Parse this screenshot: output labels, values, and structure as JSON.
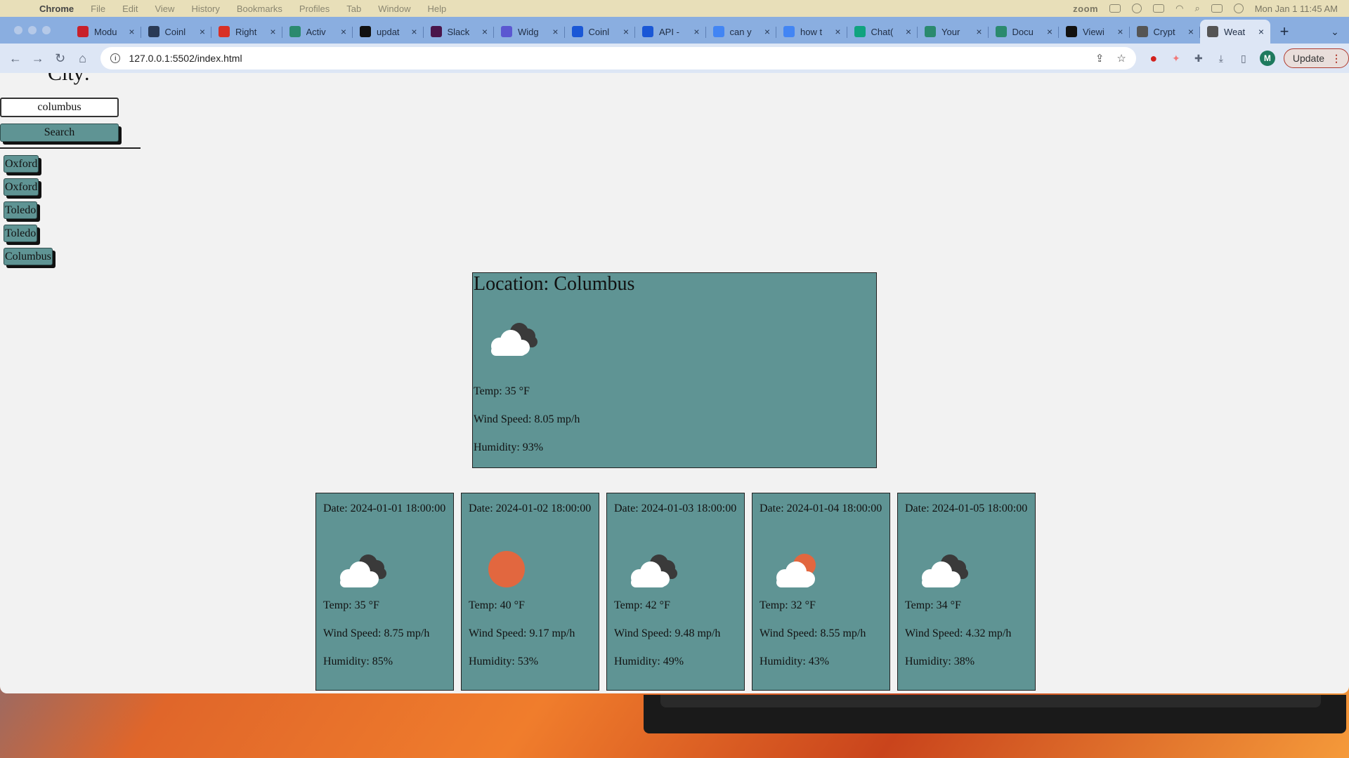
{
  "menubar": {
    "app_name": "Chrome",
    "menus": [
      "File",
      "Edit",
      "View",
      "History",
      "Bookmarks",
      "Profiles",
      "Tab",
      "Window",
      "Help"
    ],
    "zoom_label": "zoom",
    "clock": "Mon Jan 1  11:45 AM"
  },
  "tabs": [
    {
      "title": "Modu",
      "icon": "red-square-icon",
      "color": "#c8202a"
    },
    {
      "title": "Coinl",
      "icon": "coin-logo-icon",
      "color": "#2a3a55"
    },
    {
      "title": "Right",
      "icon": "gmail-icon",
      "color": "#d93025"
    },
    {
      "title": "Activ",
      "icon": "green-check-icon",
      "color": "#2b8a6e"
    },
    {
      "title": "updat",
      "icon": "github-icon",
      "color": "#111111"
    },
    {
      "title": "Slack",
      "icon": "slack-icon",
      "color": "#4a154b"
    },
    {
      "title": "Widg",
      "icon": "m-logo-icon",
      "color": "#5b57d1"
    },
    {
      "title": "Coinl",
      "icon": "c-logo-icon",
      "color": "#1a57d6"
    },
    {
      "title": "API -",
      "icon": "c-logo-icon",
      "color": "#1a57d6"
    },
    {
      "title": "can y",
      "icon": "google-icon",
      "color": "#4285f4"
    },
    {
      "title": "how t",
      "icon": "google-icon",
      "color": "#4285f4"
    },
    {
      "title": "Chat(",
      "icon": "chatgpt-icon",
      "color": "#10a37f"
    },
    {
      "title": "Your",
      "icon": "green-check-icon",
      "color": "#2b8a6e"
    },
    {
      "title": "Docu",
      "icon": "green-check-icon",
      "color": "#2b8a6e"
    },
    {
      "title": "Viewi",
      "icon": "github-icon",
      "color": "#111111"
    },
    {
      "title": "Crypt",
      "icon": "globe-icon",
      "color": "#555555"
    },
    {
      "title": "Weat",
      "icon": "globe-icon",
      "color": "#555555",
      "active": true
    }
  ],
  "toolbar": {
    "url": "127.0.0.1:5502/index.html",
    "avatar_letter": "M",
    "update_label": "Update"
  },
  "page": {
    "city_heading": "City:",
    "search_value": "columbus",
    "search_button": "Search",
    "history": [
      "Oxford",
      "Oxford",
      "Toledo",
      "Toledo",
      "Columbus"
    ],
    "current": {
      "location": "Location: Columbus",
      "icon": "cloudy-icon",
      "temp": "Temp: 35 °F",
      "wind": "Wind Speed: 8.05 mp/h",
      "humidity": "Humidity: 93%"
    },
    "forecast": [
      {
        "date": "Date: 2024-01-01 18:00:00",
        "icon": "cloudy-icon",
        "temp": "Temp: 35 °F",
        "wind": "Wind Speed: 8.75 mp/h",
        "humidity": "Humidity: 85%"
      },
      {
        "date": "Date: 2024-01-02 18:00:00",
        "icon": "sun-icon",
        "temp": "Temp: 40 °F",
        "wind": "Wind Speed: 9.17 mp/h",
        "humidity": "Humidity: 53%"
      },
      {
        "date": "Date: 2024-01-03 18:00:00",
        "icon": "cloudy-icon",
        "temp": "Temp: 42 °F",
        "wind": "Wind Speed: 9.48 mp/h",
        "humidity": "Humidity: 49%"
      },
      {
        "date": "Date: 2024-01-04 18:00:00",
        "icon": "partly-cloudy-icon",
        "temp": "Temp: 32 °F",
        "wind": "Wind Speed: 8.55 mp/h",
        "humidity": "Humidity: 43%"
      },
      {
        "date": "Date: 2024-01-05 18:00:00",
        "icon": "cloudy-icon",
        "temp": "Temp: 34 °F",
        "wind": "Wind Speed: 4.32 mp/h",
        "humidity": "Humidity: 38%"
      }
    ]
  },
  "colors": {
    "card": "#5f9494",
    "page_bg": "#f2f2f2",
    "sun": "#e2673f",
    "cloud_front": "#ffffff",
    "cloud_back": "#3a3a3a"
  }
}
